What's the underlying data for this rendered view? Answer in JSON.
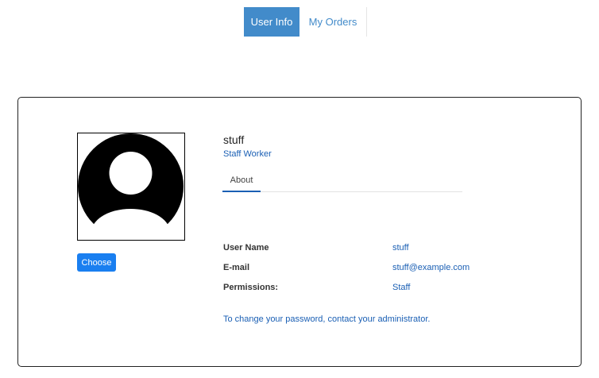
{
  "nav": {
    "tabs": [
      {
        "label": "User Info",
        "active": true
      },
      {
        "label": "My Orders",
        "active": false
      }
    ]
  },
  "profile": {
    "avatar_icon": "user-avatar-placeholder",
    "choose_label": "Choose",
    "username": "stuff",
    "role": "Staff Worker",
    "about_tab": "About",
    "fields": [
      {
        "label": "User Name",
        "value": "stuff"
      },
      {
        "label": "E-mail",
        "value": "stuff@example.com"
      },
      {
        "label": "Permissions:",
        "value": "Staff"
      }
    ],
    "password_note": "To change your password, contact your administrator."
  },
  "colors": {
    "accent": "#428bca",
    "button": "#1a7ff0",
    "link": "#1a5fb4"
  }
}
